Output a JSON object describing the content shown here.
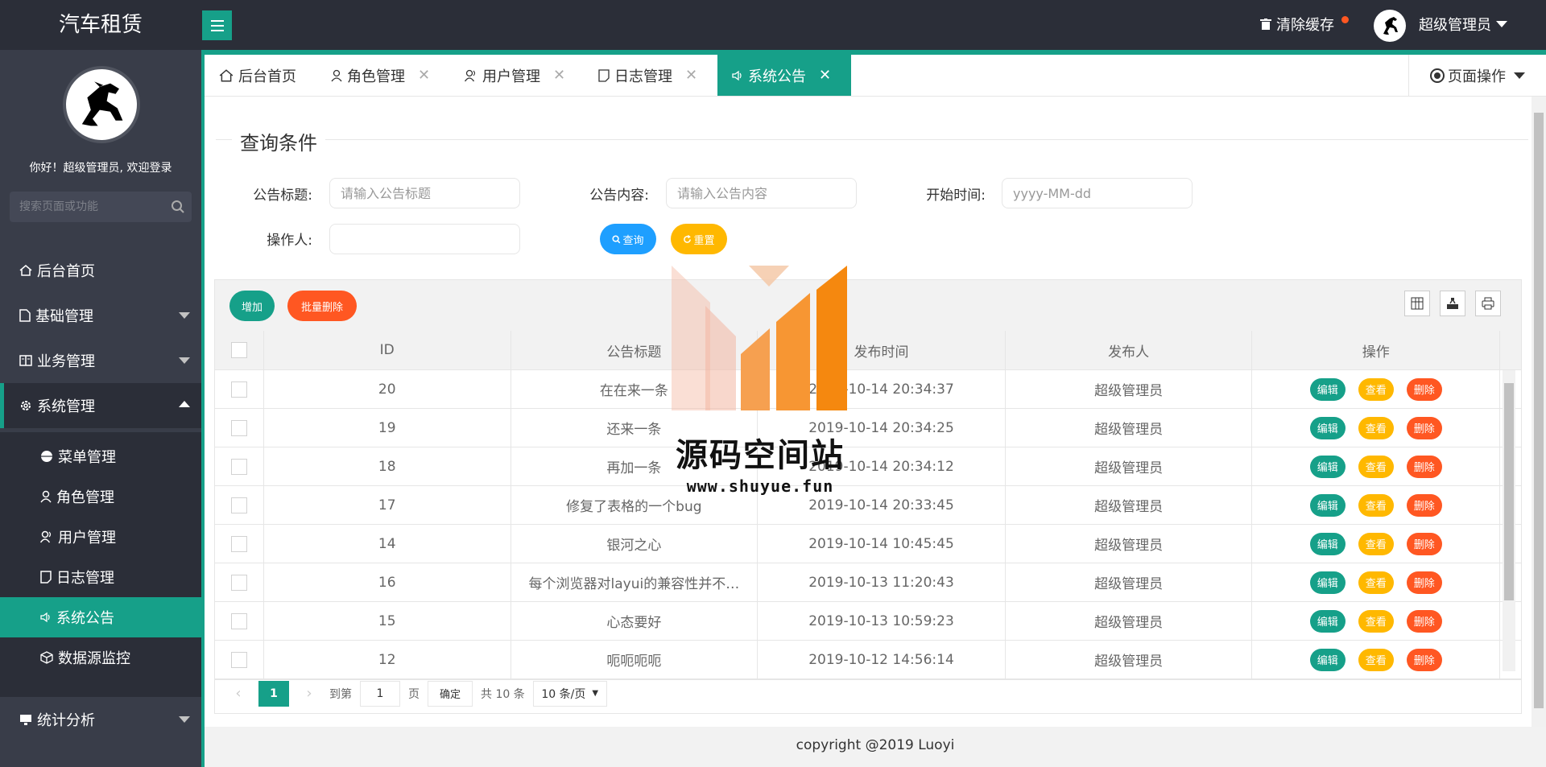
{
  "app": {
    "title": "汽车租赁",
    "clear_cache": "清除缓存",
    "user": "超级管理员"
  },
  "sidebar": {
    "welcome": "你好！超级管理员, 欢迎登录",
    "search_placeholder": "搜索页面或功能",
    "items": [
      {
        "label": "后台首页",
        "icon": "home-icon"
      },
      {
        "label": "基础管理",
        "icon": "file-icon"
      },
      {
        "label": "业务管理",
        "icon": "book-icon"
      },
      {
        "label": "系统管理",
        "icon": "gear-icon"
      },
      {
        "label": "统计分析",
        "icon": "chart-icon"
      }
    ],
    "sub_items": [
      {
        "label": "菜单管理",
        "icon": "circle-icon"
      },
      {
        "label": "角色管理",
        "icon": "user-icon"
      },
      {
        "label": "用户管理",
        "icon": "users-icon"
      },
      {
        "label": "日志管理",
        "icon": "note-icon"
      },
      {
        "label": "系统公告",
        "icon": "speaker-icon"
      },
      {
        "label": "数据源监控",
        "icon": "cube-icon"
      }
    ]
  },
  "tabs": [
    {
      "label": "后台首页"
    },
    {
      "label": "角色管理"
    },
    {
      "label": "用户管理"
    },
    {
      "label": "日志管理"
    },
    {
      "label": "系统公告"
    }
  ],
  "page_ops": "页面操作",
  "search": {
    "legend": "查询条件",
    "title_label": "公告标题:",
    "title_placeholder": "请输入公告标题",
    "content_label": "公告内容:",
    "content_placeholder": "请输入公告内容",
    "start_label": "开始时间:",
    "start_placeholder": "yyyy-MM-dd",
    "operator_label": "操作人:",
    "query_btn": "查询",
    "reset_btn": "重置"
  },
  "toolbar": {
    "add": "增加",
    "batch_delete": "批量删除"
  },
  "table": {
    "columns": [
      "ID",
      "公告标题",
      "发布时间",
      "发布人",
      "操作"
    ],
    "rows": [
      {
        "id": "20",
        "title": "在在来一条",
        "time": "2019-10-14 20:34:37",
        "publisher": "超级管理员"
      },
      {
        "id": "19",
        "title": "还来一条",
        "time": "2019-10-14 20:34:25",
        "publisher": "超级管理员"
      },
      {
        "id": "18",
        "title": "再加一条",
        "time": "2019-10-14 20:34:12",
        "publisher": "超级管理员"
      },
      {
        "id": "17",
        "title": "修复了表格的一个bug",
        "time": "2019-10-14 20:33:45",
        "publisher": "超级管理员"
      },
      {
        "id": "14",
        "title": "银河之心",
        "time": "2019-10-14 10:45:45",
        "publisher": "超级管理员"
      },
      {
        "id": "16",
        "title": "每个浏览器对layui的兼容性并不…",
        "time": "2019-10-13 11:20:43",
        "publisher": "超级管理员"
      },
      {
        "id": "15",
        "title": "心态要好",
        "time": "2019-10-13 10:59:23",
        "publisher": "超级管理员"
      },
      {
        "id": "12",
        "title": "呃呃呃呃",
        "time": "2019-10-12 14:56:14",
        "publisher": "超级管理员"
      }
    ],
    "actions": {
      "edit": "编辑",
      "view": "查看",
      "delete": "删除"
    }
  },
  "pager": {
    "current": "1",
    "goto_label": "到第",
    "goto_value": "1",
    "page_unit": "页",
    "confirm": "确定",
    "total": "共 10 条",
    "page_size": "10 条/页"
  },
  "watermark": {
    "title": "源码空间站",
    "url": "www.shuyue.fun"
  },
  "footer": "copyright @2019 Luoyi",
  "colors": {
    "accent": "#16a089",
    "header": "#2b2e38",
    "sidebar": "#393d49",
    "warm": "#ffb800",
    "danger": "#ff5722",
    "info": "#1e9fff"
  }
}
